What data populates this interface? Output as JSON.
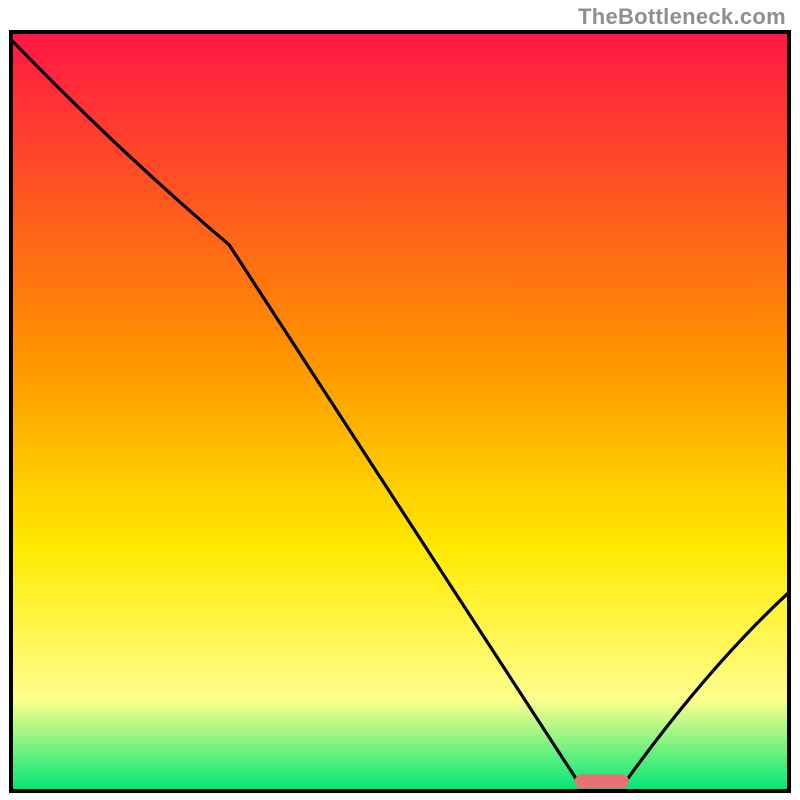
{
  "watermark": "TheBottleneck.com",
  "colors": {
    "border": "#000000",
    "curve": "#000000",
    "marker_fill": "#e57373",
    "grad_top": "#ff1744",
    "grad_mid_upper": "#ff9100",
    "grad_mid": "#ffea00",
    "grad_lower": "#ffff8d",
    "grad_bottom": "#00e676"
  },
  "chart_data": {
    "type": "line",
    "title": "",
    "xlabel": "",
    "ylabel": "",
    "xlim": [
      0,
      100
    ],
    "ylim": [
      0,
      100
    ],
    "x": [
      0,
      28,
      73,
      79,
      100
    ],
    "values": [
      99,
      72,
      1,
      1,
      26
    ],
    "marker": {
      "x_range": [
        73,
        79
      ],
      "y": 1
    },
    "annotations": []
  }
}
